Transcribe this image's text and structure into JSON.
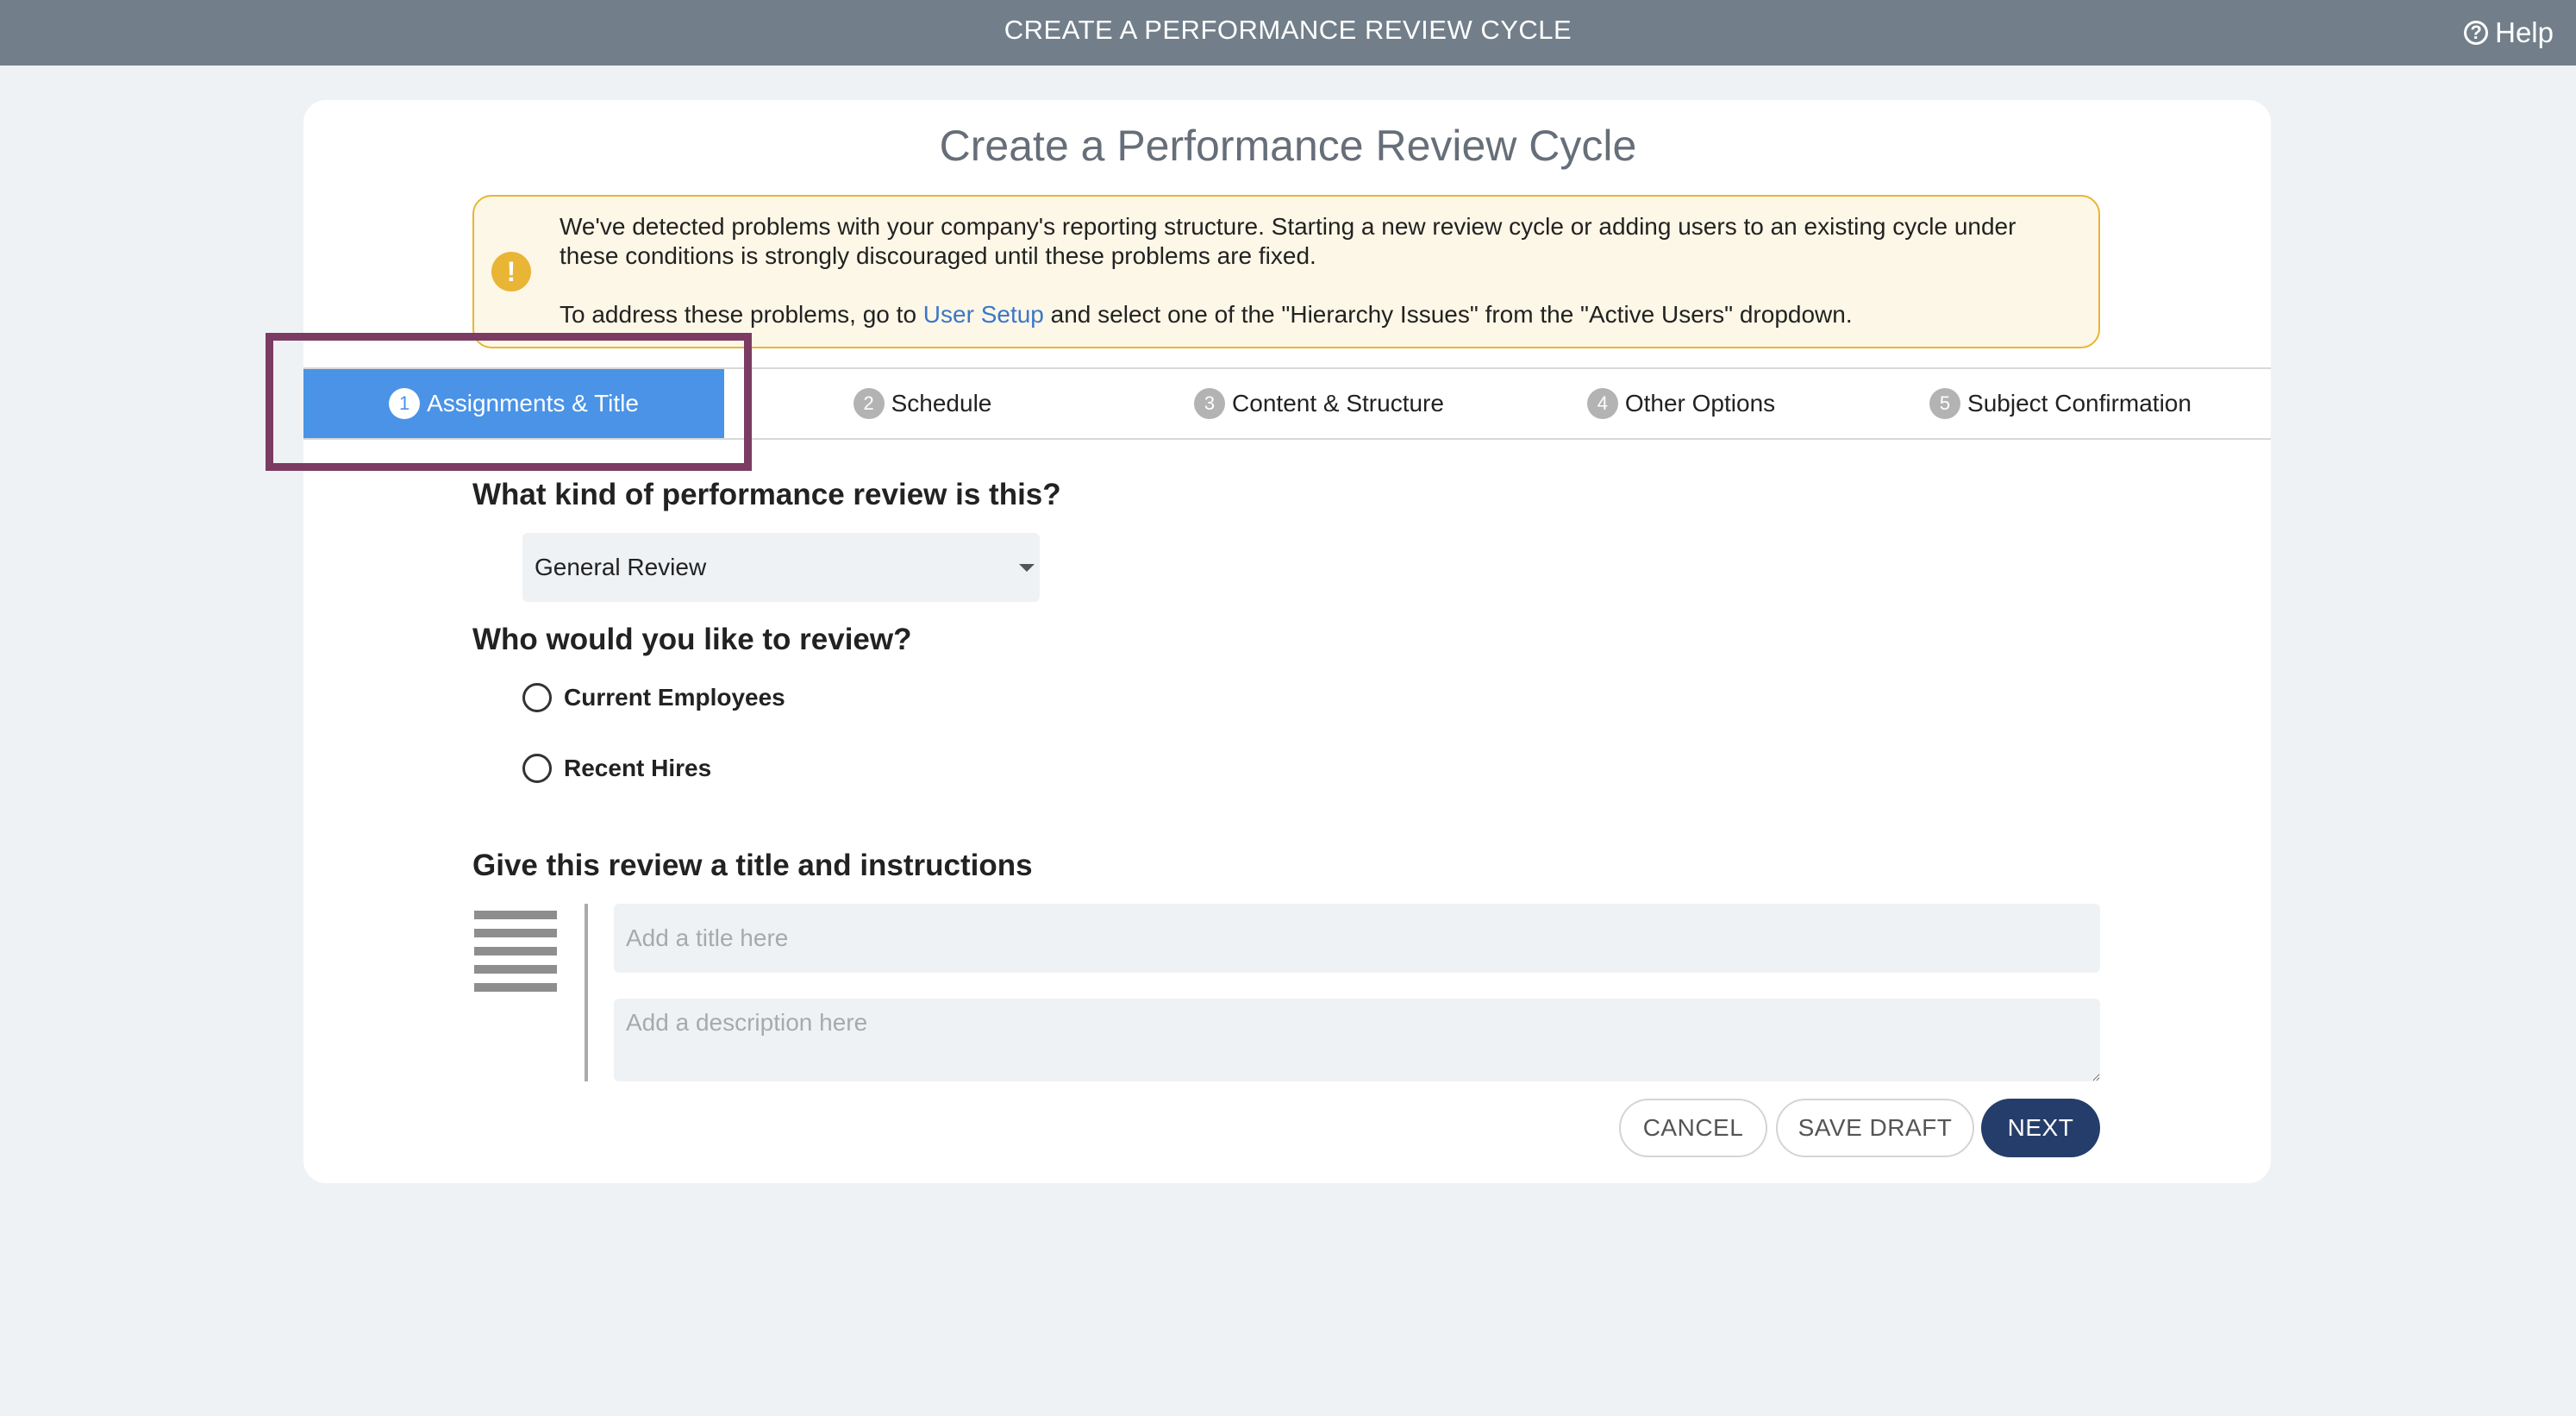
{
  "topbar": {
    "title": "CREATE A PERFORMANCE REVIEW CYCLE",
    "help_label": "Help",
    "help_icon": "?"
  },
  "card": {
    "title": "Create a Performance Review Cycle"
  },
  "warning": {
    "icon": "!",
    "line1": "We've detected problems with your company's reporting structure. Starting a new review cycle or adding users to an existing cycle under these conditions is strongly discouraged until these problems are fixed.",
    "line2_before": "To address these problems, go to ",
    "line2_link": "User Setup",
    "line2_after": " and select one of the \"Hierarchy Issues\" from the \"Active Users\" dropdown.",
    "colors": {
      "border": "#e8b534",
      "background": "#fdf7e7"
    }
  },
  "tabs": [
    {
      "num": "1",
      "label": "Assignments & Title",
      "active": true
    },
    {
      "num": "2",
      "label": "Schedule",
      "active": false
    },
    {
      "num": "3",
      "label": "Content & Structure",
      "active": false
    },
    {
      "num": "4",
      "label": "Other Options",
      "active": false
    },
    {
      "num": "5",
      "label": "Subject Confirmation",
      "active": false
    }
  ],
  "review_type": {
    "heading": "What kind of performance review is this?",
    "selected": "General Review"
  },
  "who": {
    "heading": "Who would you like to review?",
    "options": [
      "Current Employees",
      "Recent Hires"
    ]
  },
  "title_section": {
    "heading": "Give this review a title and instructions",
    "title_placeholder": "Add a title here",
    "description_placeholder": "Add a description here"
  },
  "buttons": {
    "cancel": "CANCEL",
    "save_draft": "SAVE DRAFT",
    "next": "NEXT"
  },
  "colors": {
    "topbar": "#727f8a",
    "active_tab": "#4a93e6",
    "highlight": "#7b3b63",
    "primary_button": "#253d6b",
    "link": "#3b77c8"
  }
}
